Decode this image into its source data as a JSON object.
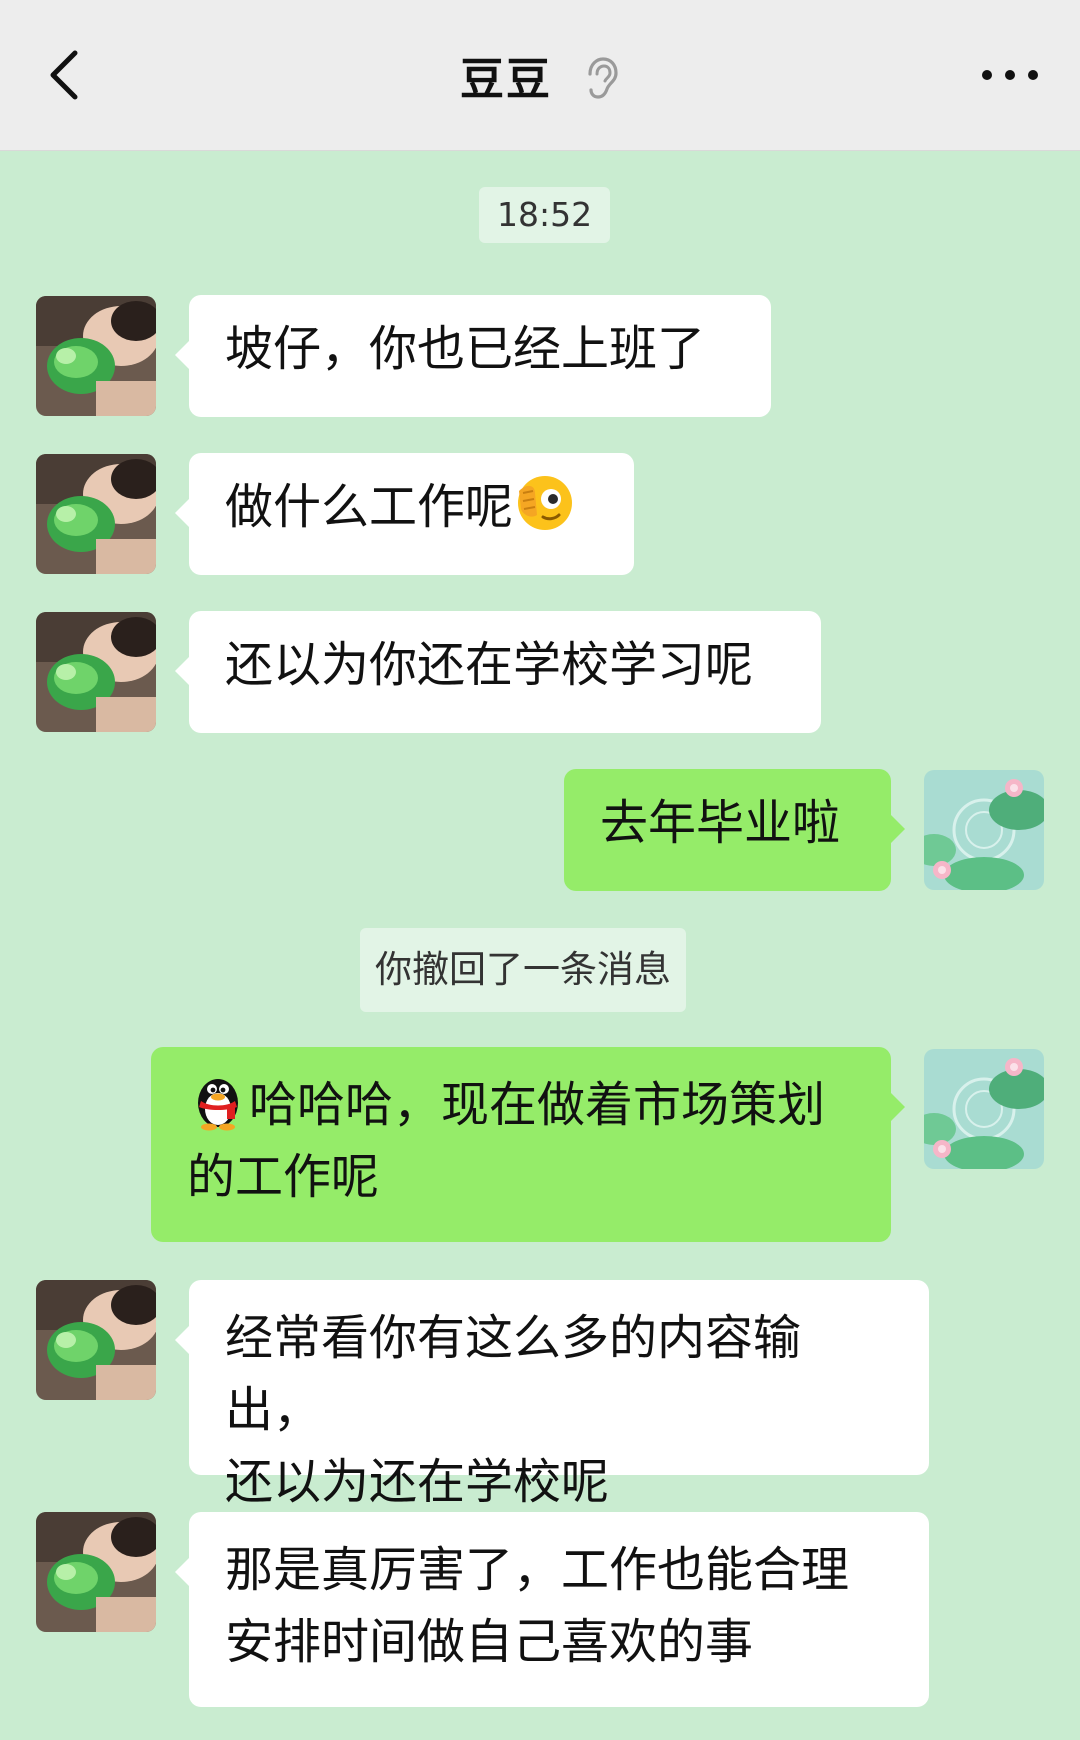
{
  "header": {
    "back_icon": "chevron-left-icon",
    "title": "豆豆",
    "ear_icon": "ear-icon",
    "more_icon": "more-dots-icon"
  },
  "chat": {
    "timestamp": "18:52",
    "recall_notice": "你撤回了一条消息",
    "messages": [
      {
        "side": "in",
        "text": "坡仔，你也已经上班了"
      },
      {
        "side": "in",
        "text": "做什么工作呢",
        "emoji": "peek-eye-emoji"
      },
      {
        "side": "in",
        "text": "还以为你还在学校学习呢"
      },
      {
        "side": "out",
        "text": "去年毕业啦"
      },
      {
        "side": "out",
        "emoji": "qq-penguin-emoji",
        "text_line1": "哈哈哈，现在做着市场策划",
        "text_line2": "的工作呢"
      },
      {
        "side": "in",
        "text_line1": "经常看你有这么多的内容输出，",
        "text_line2": "还以为还在学校呢"
      },
      {
        "side": "in",
        "text_line1": "那是真厉害了，工作也能合理",
        "text_line2": "安排时间做自己喜欢的事"
      }
    ]
  },
  "colors": {
    "chat_background": "#c9ecd0",
    "header_background": "#ededed",
    "incoming_bubble": "#ffffff",
    "outgoing_bubble": "#95ec69"
  }
}
